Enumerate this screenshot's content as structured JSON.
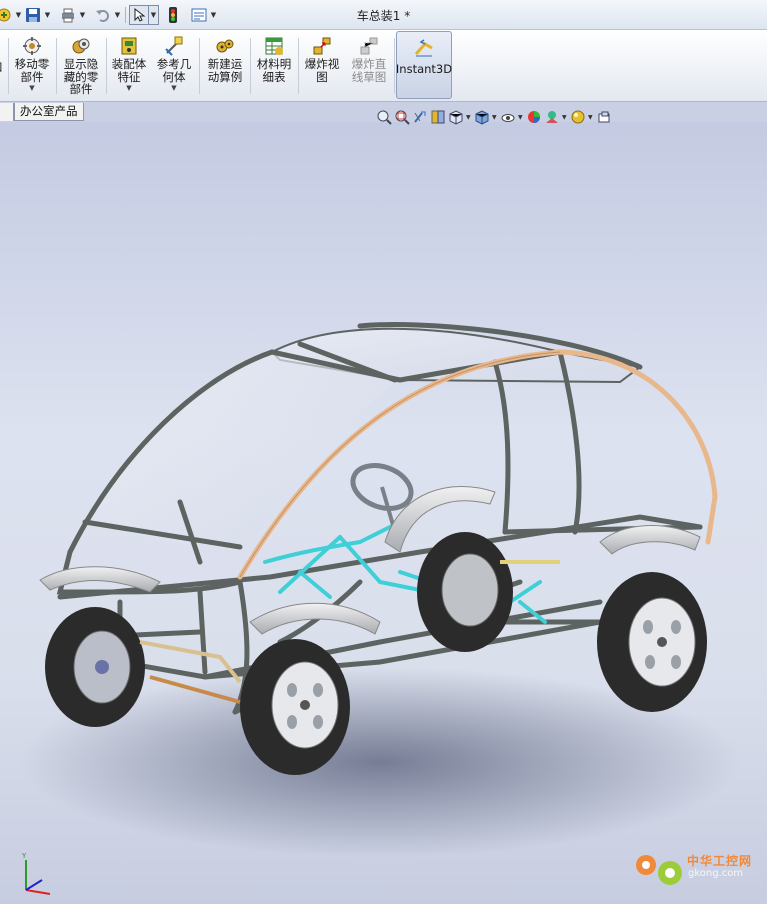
{
  "window": {
    "document_title": "车总装1 *"
  },
  "quick_access": {
    "icons": [
      "new-icon",
      "save-icon",
      "print-icon",
      "undo-icon",
      "select-icon",
      "rebuild-icon",
      "options-icon"
    ]
  },
  "command_manager": {
    "commands": [
      {
        "id": "move-component",
        "label": "移动零\n部件",
        "icon": "move-component-icon",
        "has_dropdown": true,
        "enabled": true
      },
      {
        "id": "show-hidden",
        "label": "显示隐\n藏的零\n部件",
        "icon": "show-hidden-components-icon",
        "has_dropdown": false,
        "enabled": true
      },
      {
        "id": "assembly-feature",
        "label": "装配体\n特征",
        "icon": "assembly-feature-icon",
        "has_dropdown": true,
        "enabled": true
      },
      {
        "id": "reference-geometry",
        "label": "参考几\n何体",
        "icon": "reference-geometry-icon",
        "has_dropdown": true,
        "enabled": true
      },
      {
        "id": "new-motion-study",
        "label": "新建运\n动算例",
        "icon": "motion-study-icon",
        "has_dropdown": false,
        "enabled": true
      },
      {
        "id": "bom",
        "label": "材料明\n细表",
        "icon": "bill-of-materials-icon",
        "has_dropdown": false,
        "enabled": true
      },
      {
        "id": "exploded-view",
        "label": "爆炸视\n图",
        "icon": "exploded-view-icon",
        "has_dropdown": false,
        "enabled": true
      },
      {
        "id": "explode-line",
        "label": "爆炸直\n线草图",
        "icon": "explode-line-sketch-icon",
        "has_dropdown": false,
        "enabled": false
      },
      {
        "id": "instant3d",
        "label": "Instant3D",
        "icon": "instant3d-icon",
        "has_dropdown": false,
        "enabled": true,
        "active": true
      }
    ]
  },
  "tabs": [
    {
      "label": "办公室产品"
    }
  ],
  "heads_up_toolbar": {
    "icons": [
      "zoom-to-fit-icon",
      "zoom-to-area-icon",
      "previous-view-icon",
      "section-view-icon",
      "view-orientation-icon",
      "display-style-icon",
      "hide-show-items-icon",
      "edit-appearance-icon",
      "apply-scene-icon",
      "realview-icon",
      "view-settings-icon"
    ]
  },
  "viewport": {
    "model_name": "车总装1",
    "frame_color": "#5d6360",
    "roll_bar_color": "#e8b88c",
    "steering_color": "#3fcfd6",
    "fender_color": "#d9dadc",
    "tire_color": "#2b2b2b"
  },
  "watermark": {
    "line1": "中华工控网",
    "line2": "gkong.com"
  },
  "colors": {
    "ribbon_bg": "#eef1f6",
    "viewport_top": "#c4cbe2",
    "viewport_mid": "#dde2f0",
    "active_button": "#c9d3e6"
  }
}
